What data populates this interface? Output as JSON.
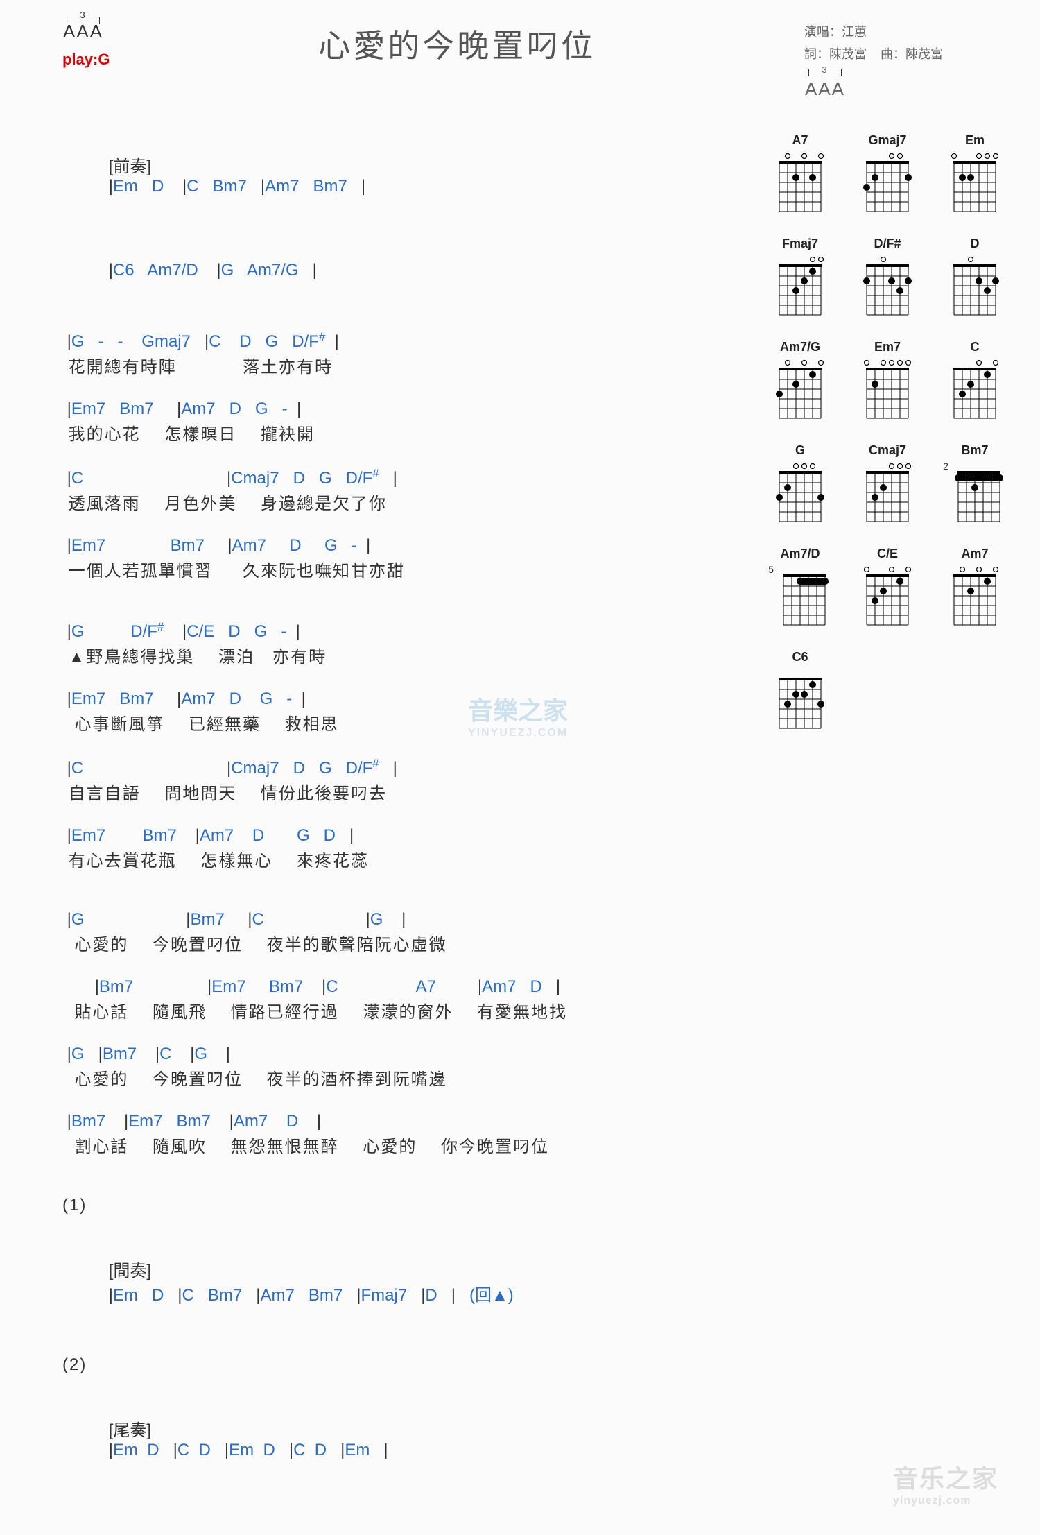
{
  "header": {
    "capo_fret": "3",
    "capo_text": "AAA",
    "play_key": "play:G",
    "title": "心愛的今晚置叼位",
    "credits": {
      "singer_label": "演唱：",
      "singer": "江蕙",
      "lyricist_label": "詞：",
      "lyricist": "陳茂富",
      "composer_label": "曲：",
      "composer": "陳茂富"
    }
  },
  "sections": {
    "intro_label": "[前奏]",
    "intro_line1": "|Em   D    |C   Bm7   |Am7   Bm7   |",
    "intro_line2": "|C6   Am7/D    |G   Am7/G   |",
    "verse1": [
      {
        "chords": " |G   -   -    Gmaj7   |C    D   G   D/F#  |",
        "lyric": " 花開總有時陣           落土亦有時"
      },
      {
        "chords": " |Em7   Bm7     |Am7   D   G   -  |",
        "lyric": " 我的心花    怎樣暝日    攏袂開"
      },
      {
        "chords": " |C                               |Cmaj7   D   G   D/F#   |",
        "lyric": " 透風落雨    月色外美    身邊總是欠了你"
      },
      {
        "chords": " |Em7              Bm7     |Am7     D     G   -  |",
        "lyric": " 一個人若孤單慣習     久來阮也嘸知甘亦甜"
      }
    ],
    "verse2": [
      {
        "chords": " |G          D/F#    |C/E   D   G   -  |",
        "lyric": " ▲野鳥總得找巢    漂泊   亦有時"
      },
      {
        "chords": " |Em7   Bm7     |Am7   D    G   -  |",
        "lyric": "  心事斷風箏    已經無藥    救相思"
      },
      {
        "chords": " |C                               |Cmaj7   D   G   D/F#   |",
        "lyric": " 自言自語    問地問天    情份此後要叼去"
      },
      {
        "chords": " |Em7        Bm7    |Am7    D       G   D   |",
        "lyric": " 有心去賞花瓶    怎樣無心    來疼花蕊"
      }
    ],
    "chorus": [
      {
        "chords": " |G                      |Bm7     |C                      |G    |",
        "lyric": "  心愛的    今晚置叼位    夜半的歌聲陪阮心虛微"
      },
      {
        "chords": "       |Bm7                |Em7     Bm7    |C                 A7         |Am7   D   |",
        "lyric": "  貼心話    隨風飛    情路已經行過    濛濛的窗外    有愛無地找"
      },
      {
        "chords": " |G   |Bm7    |C    |G    |",
        "lyric": "  心愛的    今晚置叼位    夜半的酒杯捧到阮嘴邊"
      },
      {
        "chords": " |Bm7    |Em7   Bm7    |Am7    D    |",
        "lyric": "  割心話    隨風吹    無怨無恨無醉    心愛的    你今晚置叼位"
      }
    ],
    "interlude_num": "(1)",
    "interlude_label": "[間奏]",
    "interlude_line": "|Em   D   |C   Bm7   |Am7   Bm7   |Fmaj7   |D   |   (回▲)",
    "outro_num": "(2)",
    "outro_label": "[尾奏]",
    "outro_line": "|Em  D   |C  D   |Em  D   |C  D   |Em   |"
  },
  "chord_diagrams": [
    {
      "name": "A7",
      "base": "",
      "open": [
        0,
        1,
        0,
        1,
        0,
        1
      ],
      "dots": [
        [
          2,
          4
        ],
        [
          2,
          2
        ]
      ]
    },
    {
      "name": "Gmaj7",
      "base": "",
      "open": [
        0,
        0,
        0,
        1,
        1,
        0
      ],
      "dots": [
        [
          3,
          6
        ],
        [
          2,
          5
        ],
        [
          2,
          1
        ]
      ]
    },
    {
      "name": "Em",
      "base": "",
      "open": [
        1,
        0,
        0,
        1,
        1,
        1
      ],
      "dots": [
        [
          2,
          5
        ],
        [
          2,
          4
        ]
      ]
    },
    {
      "name": "Fmaj7",
      "base": "",
      "open": [
        0,
        0,
        0,
        0,
        1,
        1
      ],
      "dots": [
        [
          1,
          2
        ],
        [
          2,
          3
        ],
        [
          3,
          4
        ]
      ]
    },
    {
      "name": "D/F#",
      "base": "",
      "open": [
        0,
        0,
        1,
        0,
        0,
        0
      ],
      "dots": [
        [
          2,
          6
        ],
        [
          2,
          3
        ],
        [
          3,
          2
        ],
        [
          2,
          1
        ]
      ]
    },
    {
      "name": "D",
      "base": "",
      "open": [
        0,
        0,
        1,
        0,
        0,
        0
      ],
      "dots": [
        [
          2,
          3
        ],
        [
          3,
          2
        ],
        [
          2,
          1
        ]
      ]
    },
    {
      "name": "Am7/G",
      "base": "",
      "open": [
        0,
        1,
        0,
        1,
        0,
        1
      ],
      "dots": [
        [
          3,
          6
        ],
        [
          2,
          4
        ],
        [
          1,
          2
        ]
      ]
    },
    {
      "name": "Em7",
      "base": "",
      "open": [
        1,
        0,
        1,
        1,
        1,
        1
      ],
      "dots": [
        [
          2,
          5
        ]
      ]
    },
    {
      "name": "C",
      "base": "",
      "open": [
        0,
        0,
        0,
        1,
        0,
        1
      ],
      "dots": [
        [
          3,
          5
        ],
        [
          2,
          4
        ],
        [
          1,
          2
        ]
      ]
    },
    {
      "name": "G",
      "base": "",
      "open": [
        0,
        0,
        1,
        1,
        1,
        0
      ],
      "dots": [
        [
          3,
          6
        ],
        [
          2,
          5
        ],
        [
          3,
          1
        ]
      ]
    },
    {
      "name": "Cmaj7",
      "base": "",
      "open": [
        0,
        0,
        0,
        1,
        1,
        1
      ],
      "dots": [
        [
          3,
          5
        ],
        [
          2,
          4
        ]
      ]
    },
    {
      "name": "Bm7",
      "base": "2",
      "open": [
        0,
        0,
        0,
        0,
        0,
        0
      ],
      "dots": [
        [
          1,
          6
        ],
        [
          2,
          4
        ],
        [
          1,
          1
        ]
      ],
      "barre": [
        1,
        1,
        6
      ]
    },
    {
      "name": "Am7/D",
      "base": "5",
      "open": [
        0,
        0,
        0,
        0,
        0,
        0
      ],
      "dots": [
        [
          1,
          4
        ],
        [
          1,
          3
        ],
        [
          1,
          2
        ],
        [
          1,
          1
        ]
      ],
      "barre": [
        1,
        1,
        4
      ]
    },
    {
      "name": "C/E",
      "base": "",
      "open": [
        1,
        0,
        0,
        1,
        0,
        1
      ],
      "dots": [
        [
          3,
          5
        ],
        [
          2,
          4
        ],
        [
          1,
          2
        ]
      ]
    },
    {
      "name": "Am7",
      "base": "",
      "open": [
        0,
        1,
        0,
        1,
        0,
        1
      ],
      "dots": [
        [
          2,
          4
        ],
        [
          1,
          2
        ]
      ]
    },
    {
      "name": "C6",
      "base": "",
      "open": [
        0,
        0,
        0,
        0,
        0,
        0
      ],
      "dots": [
        [
          3,
          5
        ],
        [
          2,
          4
        ],
        [
          2,
          3
        ],
        [
          1,
          2
        ],
        [
          3,
          1
        ]
      ]
    }
  ],
  "watermark": {
    "main": "音乐之家",
    "sub": "yinyuezj.com",
    "center": "音樂之家",
    "center_sub": "YINYUEZJ.COM"
  }
}
